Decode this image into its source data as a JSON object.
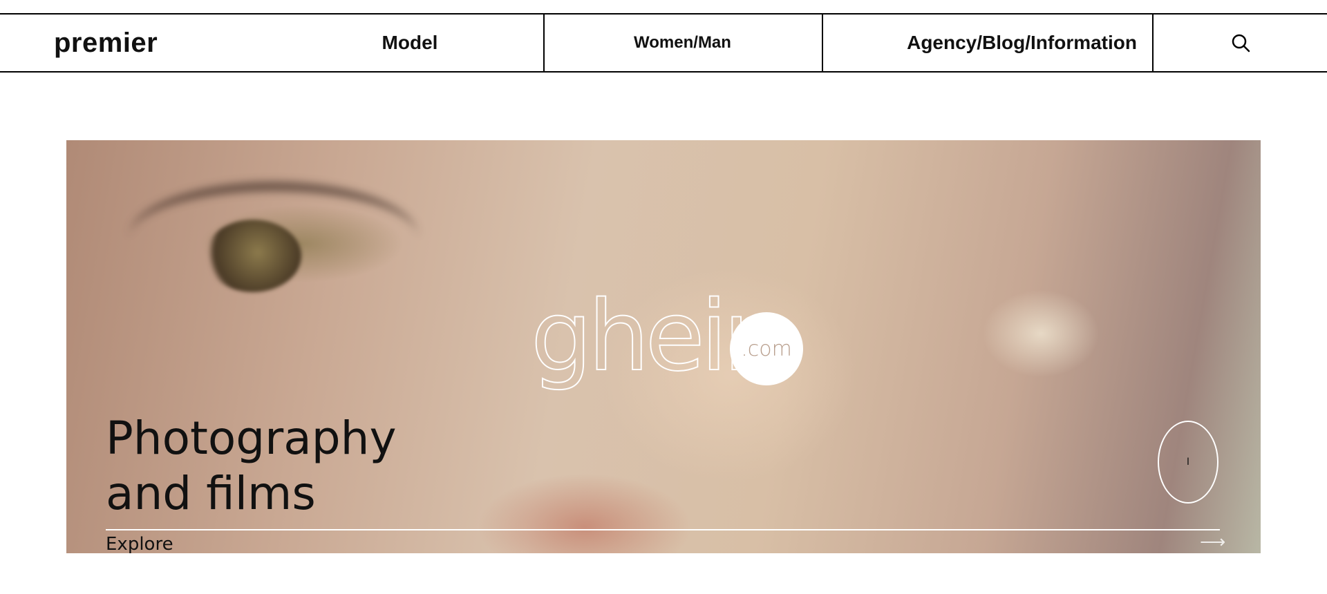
{
  "header": {
    "brand": "premier",
    "nav": {
      "model": "Model",
      "women_man": "Women/Man",
      "agency": "Agency/Blog/Information"
    },
    "search_icon": "search-icon"
  },
  "hero": {
    "logo_text": "gheir",
    "logo_suffix": ".com",
    "title_line1": "Photography",
    "title_line2": "and films",
    "play_label": "I",
    "explore_label": "Explore",
    "arrow_icon": "arrow-right-icon",
    "arrow_glyph": "⟶"
  },
  "colors": {
    "text": "#111111",
    "border": "#000000",
    "overlay": "#ffffff"
  }
}
